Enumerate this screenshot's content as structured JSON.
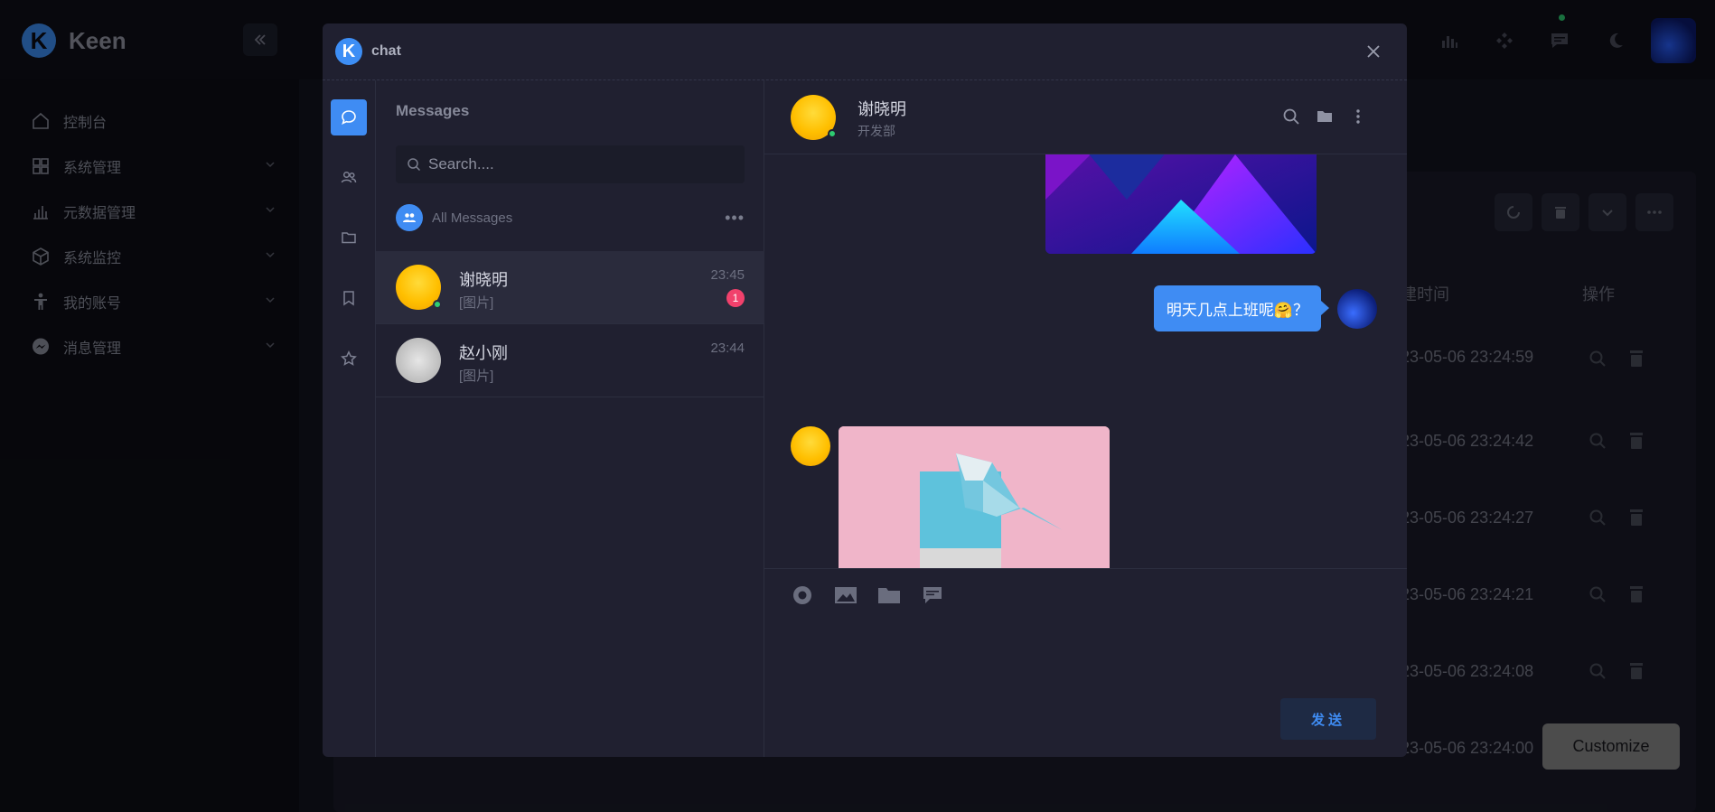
{
  "app": {
    "logo_letter": "K",
    "brand": "Keen",
    "collapse_icon": "double-chevron-left-icon"
  },
  "sidebar": {
    "items": [
      {
        "label": "控制台",
        "icon": "home-icon"
      },
      {
        "label": "系统管理",
        "icon": "grid-icon"
      },
      {
        "label": "元数据管理",
        "icon": "bar-chart-icon"
      },
      {
        "label": "系统监控",
        "icon": "cube-icon"
      },
      {
        "label": "我的账号",
        "icon": "person-icon"
      },
      {
        "label": "消息管理",
        "icon": "messenger-icon"
      }
    ]
  },
  "table": {
    "header_time": "建时间",
    "header_actions": "操作",
    "rows": [
      {
        "time": "23-05-06 23:24:59"
      },
      {
        "time": "23-05-06 23:24:42"
      },
      {
        "time": "23-05-06 23:24:27"
      },
      {
        "time": "23-05-06 23:24:21"
      },
      {
        "time": "23-05-06 23:24:08"
      },
      {
        "time": "23-05-06 23:24:00"
      }
    ]
  },
  "customize_label": "Customize",
  "modal": {
    "logo_letter": "K",
    "title": "chat",
    "list_title": "Messages",
    "search_placeholder": "Search....",
    "all_messages_label": "All Messages",
    "more_label": "•••",
    "conversations": [
      {
        "name": "谢晓明",
        "preview": "[图片]",
        "time": "23:45",
        "unread": "1",
        "online": true
      },
      {
        "name": "赵小刚",
        "preview": "[图片]",
        "time": "23:44",
        "unread": "",
        "online": false
      }
    ],
    "chat": {
      "name": "谢晓明",
      "department": "开发部",
      "sent_message": "明天几点上班呢🤗？",
      "send_label": "发送"
    }
  },
  "colors": {
    "accent": "#3f8cf3",
    "online": "#2ecc71",
    "badge": "#f1416c"
  }
}
